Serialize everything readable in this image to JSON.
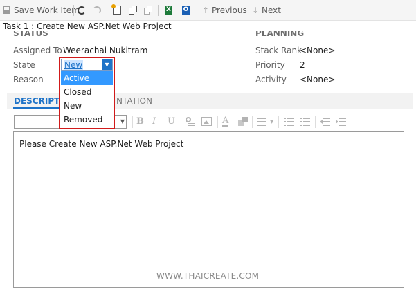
{
  "toolbar": {
    "save_label": "Save Work Item",
    "excel_glyph": "X",
    "outlook_glyph": "O",
    "previous_label": "Previous",
    "next_label": "Next"
  },
  "task": {
    "title": "Task 1 : Create New ASP.Net Web Project"
  },
  "status": {
    "heading": "STATUS",
    "assigned_to_label": "Assigned To",
    "assigned_to_value": "Weerachai Nukitram",
    "state_label": "State",
    "state_value": "New",
    "reason_label": "Reason",
    "state_options": [
      "Active",
      "Closed",
      "New",
      "Removed"
    ]
  },
  "planning": {
    "heading": "PLANNING",
    "stack_rank_label": "Stack Rank",
    "stack_rank_value": "<None>",
    "priority_label": "Priority",
    "priority_value": "2",
    "activity_label": "Activity",
    "activity_value": "<None>"
  },
  "tabs": {
    "description_visible": "DESCRIPTIO",
    "implementation_visible": "NTATION"
  },
  "editor": {
    "bold_glyph": "B",
    "italic_glyph": "I",
    "underline_glyph": "U",
    "font_color_glyph": "A",
    "body_text": "Please Create New ASP.Net Web Project"
  },
  "watermark": "WWW.THAICREATE.COM",
  "colors": {
    "accent_blue": "#1e73c8",
    "highlight": "#3399ff",
    "dropdown_border": "#d11a1a"
  }
}
